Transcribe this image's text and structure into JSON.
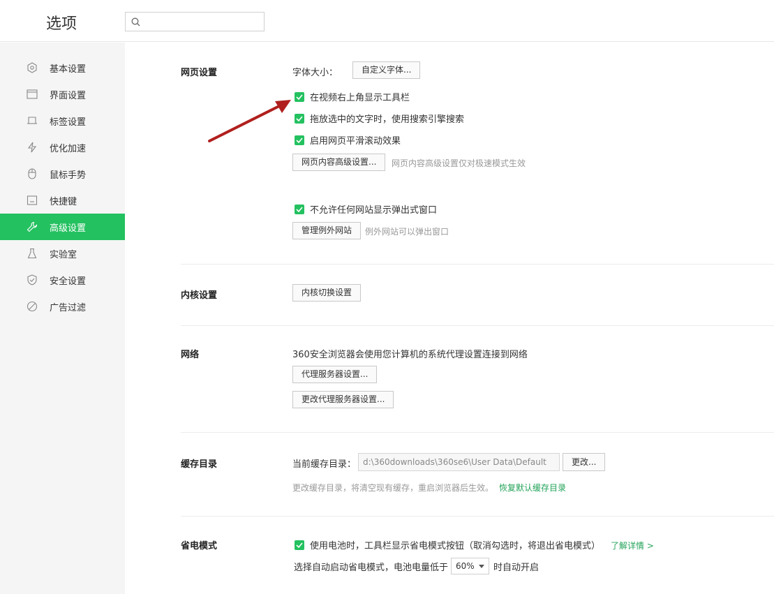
{
  "header": {
    "title": "选项",
    "search_placeholder": ""
  },
  "sidebar": {
    "items": [
      {
        "label": "基本设置",
        "icon": "settings-icon"
      },
      {
        "label": "界面设置",
        "icon": "window-icon"
      },
      {
        "label": "标签设置",
        "icon": "tab-icon"
      },
      {
        "label": "优化加速",
        "icon": "lightning-icon"
      },
      {
        "label": "鼠标手势",
        "icon": "mouse-icon"
      },
      {
        "label": "快捷键",
        "icon": "keyboard-icon"
      },
      {
        "label": "高级设置",
        "icon": "wrench-icon",
        "active": true
      },
      {
        "label": "实验室",
        "icon": "flask-icon"
      },
      {
        "label": "安全设置",
        "icon": "shield-icon"
      },
      {
        "label": "广告过滤",
        "icon": "block-icon"
      }
    ]
  },
  "web": {
    "title": "网页设置",
    "font_size_label": "字体大小：",
    "custom_font_button": "自定义字体...",
    "cb_video_toolbar": "在视频右上角显示工具栏",
    "cb_drag_search": "拖放选中的文字时，使用搜索引擎搜索",
    "cb_smooth_scroll": "启用网页平滑滚动效果",
    "advanced_content_button": "网页内容高级设置...",
    "advanced_content_hint": "网页内容高级设置仅对极速模式生效",
    "cb_block_popups": "不允许任何网站显示弹出式窗口",
    "manage_exceptions_button": "管理例外网站",
    "manage_exceptions_hint": "例外网站可以弹出窗口"
  },
  "kernel": {
    "title": "内核设置",
    "switch_button": "内核切换设置"
  },
  "network": {
    "title": "网络",
    "desc": "360安全浏览器会使用您计算机的系统代理设置连接到网络",
    "proxy_button": "代理服务器设置...",
    "change_proxy_button": "更改代理服务器设置..."
  },
  "cache": {
    "title": "缓存目录",
    "label": "当前缓存目录：",
    "path": "d:\\360downloads\\360se6\\User Data\\Default",
    "change_button": "更改...",
    "hint": "更改缓存目录，将清空现有缓存，重启浏览器后生效。",
    "restore_link": "恢复默认缓存目录"
  },
  "power": {
    "title": "省电模式",
    "cb_battery": "使用电池时，工具栏显示省电模式按钮（取消勾选时，将退出省电模式）",
    "more_link": "了解详情 >",
    "auto_prefix": "选择自动启动省电模式，电池电量低于",
    "threshold": "60%",
    "auto_suffix": "时自动开启"
  },
  "colors": {
    "accent": "#24c160",
    "arrow": "#b0201e"
  }
}
